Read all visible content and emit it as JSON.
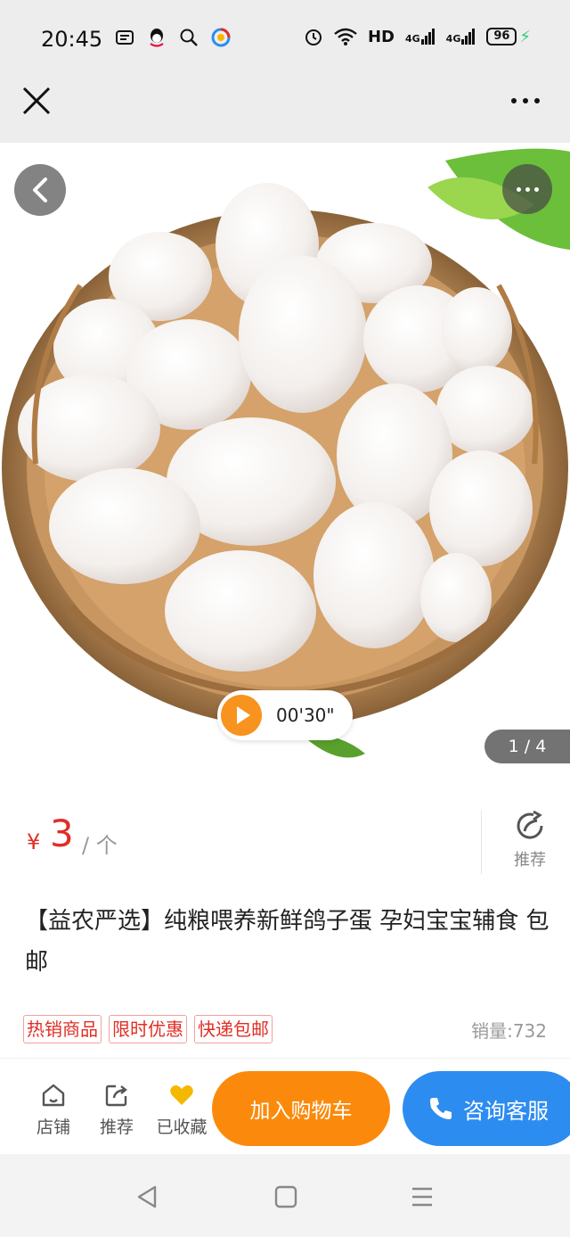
{
  "status_bar": {
    "time": "20:45",
    "network_label": "HD",
    "signal_1": "4G",
    "signal_2": "4G",
    "battery": "96"
  },
  "nav": {
    "close_icon": "close-icon",
    "more_icon": "more-icon"
  },
  "media": {
    "video_duration": "00'30\"",
    "page_indicator": "1 / 4"
  },
  "product": {
    "currency": "¥",
    "price": "3",
    "unit": "/ 个",
    "share_label": "推荐",
    "title": "【益农严选】纯粮喂养新鲜鸽子蛋 孕妇宝宝辅食 包邮",
    "tags": [
      "热销商品",
      "限时优惠",
      "快递包邮"
    ],
    "sales": "销量:732"
  },
  "bottom_bar": {
    "store_label": "店铺",
    "recommend_label": "推荐",
    "favorite_label": "已收藏",
    "cart_label": "加入购物车",
    "service_label": "咨询客服"
  },
  "colors": {
    "price_red": "#e02e24",
    "cart_orange": "#fb8a0c",
    "service_blue": "#2d8cf0",
    "heart_yellow": "#f5b800"
  }
}
